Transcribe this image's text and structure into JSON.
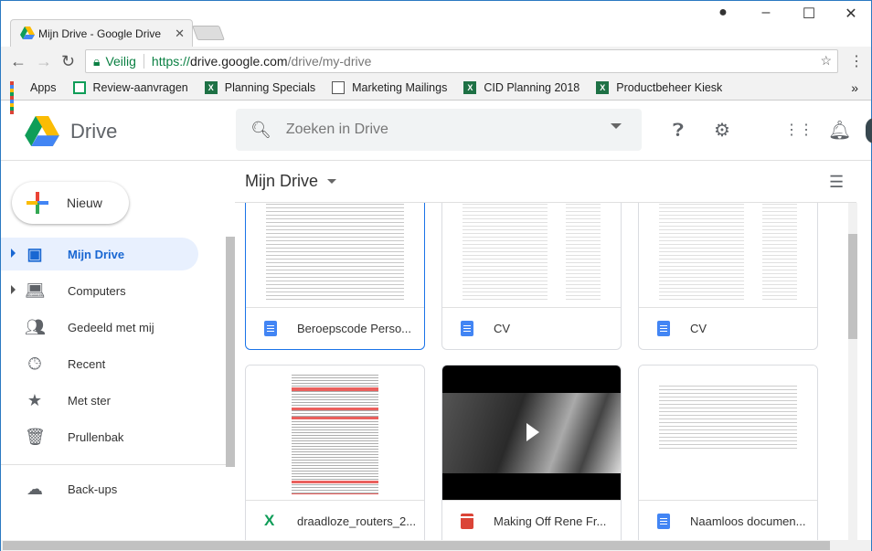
{
  "browser": {
    "tab_title": "Mijn Drive - Google Drive",
    "secure_label": "Veilig",
    "url_scheme": "https://",
    "url_host": "drive.google.com",
    "url_path": "/drive/my-drive",
    "bookmarks": [
      {
        "label": "Apps",
        "icon": "apps-icon"
      },
      {
        "label": "Review-aanvragen",
        "icon": "sheets-icon"
      },
      {
        "label": "Planning Specials",
        "icon": "excel-icon"
      },
      {
        "label": "Marketing Mailings",
        "icon": "document-icon"
      },
      {
        "label": "CID Planning 2018",
        "icon": "excel-icon"
      },
      {
        "label": "Productbeheer Kiesk",
        "icon": "excel-icon"
      }
    ],
    "more": "»"
  },
  "header": {
    "logo_text": "Drive",
    "search_placeholder": "Zoeken in Drive"
  },
  "sidebar": {
    "new_label": "Nieuw",
    "items": [
      {
        "label": "Mijn Drive",
        "active": true
      },
      {
        "label": "Computers"
      },
      {
        "label": "Gedeeld met mij"
      },
      {
        "label": "Recent"
      },
      {
        "label": "Met ster"
      },
      {
        "label": "Prullenbak"
      },
      {
        "label": "Back-ups"
      }
    ]
  },
  "main": {
    "title": "Mijn Drive",
    "files": [
      {
        "name": "Beroepscode Perso...",
        "type": "doc"
      },
      {
        "name": "CV",
        "type": "doc"
      },
      {
        "name": "CV",
        "type": "doc"
      },
      {
        "name": "draadloze_routers_2...",
        "type": "xls"
      },
      {
        "name": "Making Off Rene Fr...",
        "type": "video"
      },
      {
        "name": "Naamloos documen...",
        "type": "doc"
      }
    ]
  },
  "colors": {
    "accent": "#1967d2",
    "active_bg": "#e8f0fe"
  }
}
